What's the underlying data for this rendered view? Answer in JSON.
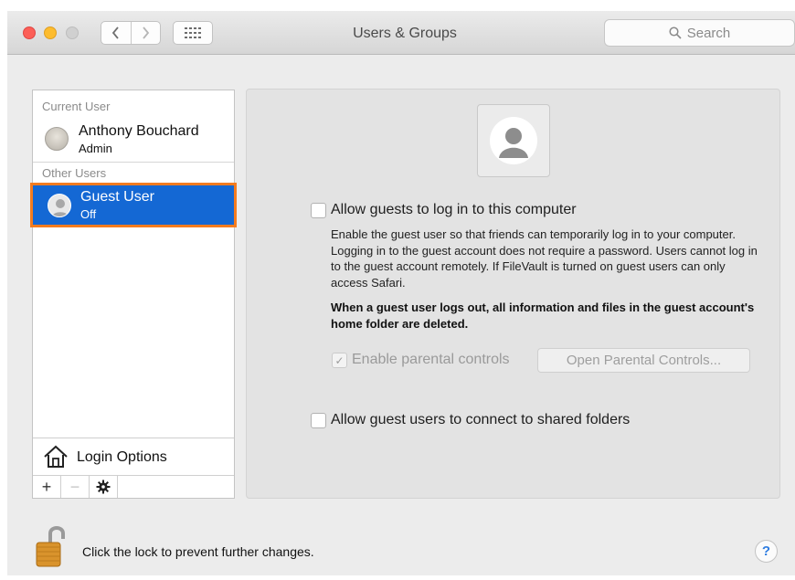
{
  "window": {
    "title": "Users & Groups",
    "search_placeholder": "Search"
  },
  "sidebar": {
    "current_user_label": "Current User",
    "current_user": {
      "name": "Anthony Bouchard",
      "role": "Admin"
    },
    "other_users_label": "Other Users",
    "guest_user": {
      "name": "Guest User",
      "status": "Off",
      "selected": true
    },
    "login_options_label": "Login Options",
    "bottom_buttons": [
      "+",
      "−",
      "gear-icon"
    ]
  },
  "panel": {
    "allow_guests_label": "Allow guests to log in to this computer",
    "allow_guests_checked": false,
    "description": "Enable the guest user so that friends can temporarily log in to your computer. Logging in to the guest account does not require a password. Users cannot log in to the guest account remotely. If FileVault is turned on guest users can only access Safari.",
    "warning": "When a guest user logs out, all information and files in the guest account's home folder are deleted.",
    "parental_controls_label": "Enable parental controls",
    "parental_controls_checked": true,
    "parental_controls_enabled": false,
    "open_parental_controls_label": "Open Parental Controls...",
    "shared_folders_label": "Allow guest users to connect to shared folders",
    "shared_folders_checked": false
  },
  "footer": {
    "lock_text": "Click the lock to prevent further changes.",
    "help_label": "?"
  },
  "colors": {
    "selection": "#1468d4",
    "highlight_outline": "#f57c1f",
    "close": "#fc5f57",
    "minimize": "#fdbc2e"
  }
}
